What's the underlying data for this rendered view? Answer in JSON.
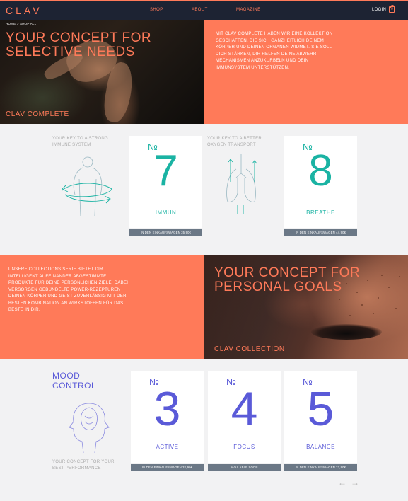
{
  "header": {
    "logo": "CLAV",
    "nav": [
      "SHOP",
      "ABOUT",
      "MAGAZINE"
    ],
    "login": "LOGIN",
    "cart_count": "0"
  },
  "breadcrumb": "HOME > SHOP ALL",
  "hero1": {
    "title_line1": "YOUR CONCEPT FOR",
    "title_line2": "SELECTIVE NEEDS",
    "subtitle": "CLAV COMPLETE",
    "text": "MIT CLAV COMPLETE HABEN WIR EINE KOLLEKTION GESCHAFFEN, DIE SICH GANZHEITLICH DEINEM KÖRPER UND DEINEN ORGANEN WIDMET. SIE SOLL DICH STÄRKEN, DIR HELFEN DEINE ABWEHR-MECHANISMEN ANZUKURBELN UND DEIN IMMUNSYSTEM UNTERSTÜTZEN."
  },
  "section1": {
    "key1": "YOUR KEY TO A STRONG IMMUNE SYSTEM",
    "key2": "YOUR KEY TO A BETTER OXYGEN TRANSPORT",
    "cards": [
      {
        "no": "№",
        "number": "7",
        "label": "IMMUN",
        "bar": "IN DEN EINKAUFSWAGEN   35,90€"
      },
      {
        "no": "№",
        "number": "8",
        "label": "BREATHE",
        "bar": "IN DEN EINKAUFSWAGEN   44,90€"
      }
    ]
  },
  "hero2": {
    "text": "UNSERE COLLECTIONS SERIE BIETET DIR INTELLIGENT AUFEINANDER ABGESTIMMTE PRODUKTE FÜR DEINE PERSÖNLICHEN ZIELE. DABEI VERSORGEN GEBÜNDELTE POWER-REZEPTUREN DEINEN KÖRPER UND GEIST ZUVERLÄSSIG MIT DER BESTEN KOMBINATION AN WIRKSTOFFEN FÜR DAS BESTE IN DIR.",
    "title_line1": "YOUR CONCEPT FOR",
    "title_line2": "PERSONAL GOALS",
    "subtitle": "CLAV COLLECTION"
  },
  "section3": {
    "title_line1": "MOOD",
    "title_line2": "CONTROL",
    "foot": "YOUR CONCEPT FOR YOUR BEST PERFORMANCE",
    "cards": [
      {
        "no": "№",
        "number": "3",
        "label": "ACTIVE",
        "bar": "IN DEN EINKAUFSWAGEN   32,90€"
      },
      {
        "no": "№",
        "number": "4",
        "label": "FOCUS",
        "bar": "AVAILABLE SOON"
      },
      {
        "no": "№",
        "number": "5",
        "label": "BALANCE",
        "bar": "IN DEN EINKAUFSWAGEN   23,90€"
      }
    ],
    "arrow_prev": "←",
    "arrow_next": "→"
  },
  "colors": {
    "accent": "#ff7a59",
    "navy": "#1d2333",
    "teal": "#1ab3a3",
    "violet": "#5a5ad8",
    "bar": "#6b7886"
  },
  "icons": [
    "shopping-bag-icon",
    "immune-body-illustration",
    "lungs-illustration",
    "heads-profile-illustration",
    "arrow-left-icon",
    "arrow-right-icon"
  ]
}
